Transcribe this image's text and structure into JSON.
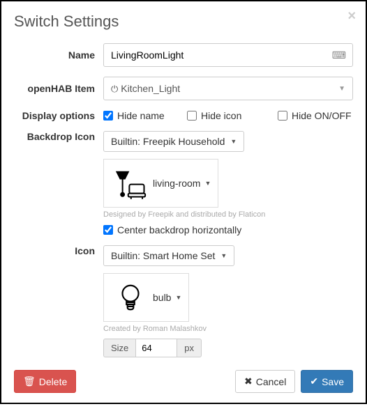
{
  "modal": {
    "title": "Switch Settings"
  },
  "form": {
    "name_label": "Name",
    "name_value": "LivingRoomLight",
    "item_label": "openHAB Item",
    "item_value": "Kitchen_Light",
    "display_options_label": "Display options",
    "hide_name_label": "Hide name",
    "hide_name_checked": true,
    "hide_icon_label": "Hide icon",
    "hide_icon_checked": false,
    "hide_onoff_label": "Hide ON/OFF",
    "hide_onoff_checked": false,
    "backdrop_label": "Backdrop Icon",
    "backdrop_iconset": "Builtin: Freepik Household",
    "backdrop_icon_name": "living-room",
    "backdrop_credit": "Designed by Freepik and distributed by Flaticon",
    "center_backdrop_label": "Center backdrop horizontally",
    "center_backdrop_checked": true,
    "icon_label": "Icon",
    "icon_iconset": "Builtin: Smart Home Set",
    "icon_name": "bulb",
    "icon_credit": "Created by Roman Malashkov",
    "size_label": "Size",
    "size_value": "64",
    "size_unit": "px"
  },
  "footer": {
    "delete_label": "Delete",
    "cancel_label": "Cancel",
    "save_label": "Save"
  }
}
